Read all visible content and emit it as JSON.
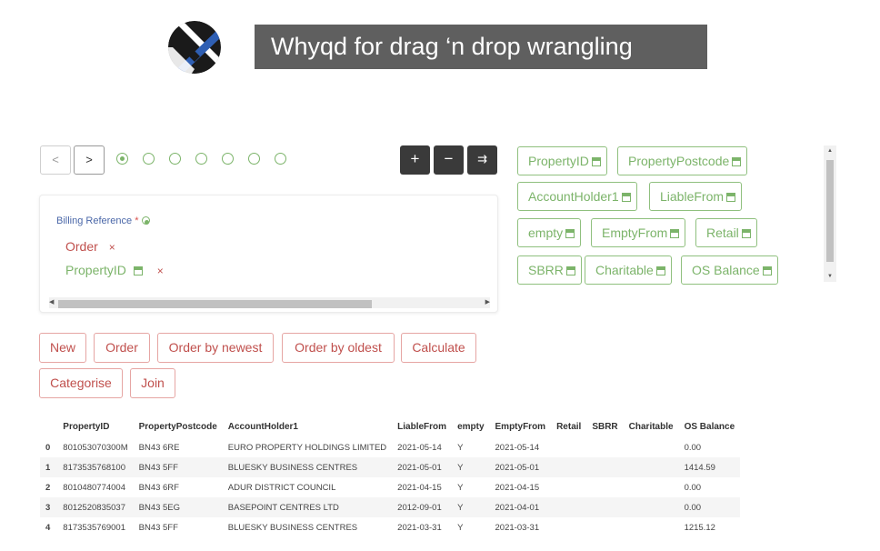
{
  "header": {
    "title": "Whyqd for drag ‘n drop wrangling"
  },
  "pager": {
    "prev_label": "<",
    "next_label": ">",
    "step_count": 7,
    "active_step": 1
  },
  "toolbar": {
    "add_label": "+",
    "remove_label": "−",
    "expand_label": "⇉"
  },
  "card": {
    "billing_label": "Billing Reference",
    "required_mark": "*",
    "items": [
      {
        "label": "Order",
        "remove": "×"
      },
      {
        "label": "PropertyID",
        "remove": "×"
      }
    ]
  },
  "fields": [
    "PropertyID",
    "PropertyPostcode",
    "AccountHolder1",
    "LiableFrom",
    "empty",
    "EmptyFrom",
    "Retail",
    "SBRR",
    "Charitable",
    "OS Balance"
  ],
  "actions": [
    "New",
    "Order",
    "Order by newest",
    "Order by oldest",
    "Calculate",
    "Categorise",
    "Join"
  ],
  "table": {
    "columns": [
      "",
      "PropertyID",
      "PropertyPostcode",
      "AccountHolder1",
      "LiableFrom",
      "empty",
      "EmptyFrom",
      "Retail",
      "SBRR",
      "Charitable",
      "OS Balance"
    ],
    "rows": [
      [
        "0",
        "801053070300M",
        "BN43 6RE",
        "EURO PROPERTY HOLDINGS LIMITED",
        "2021-05-14",
        "Y",
        "2021-05-14",
        "",
        "",
        "",
        "0.00"
      ],
      [
        "1",
        "8173535768100",
        "BN43 5FF",
        "BLUESKY BUSINESS CENTRES",
        "2021-05-01",
        "Y",
        "2021-05-01",
        "",
        "",
        "",
        "1414.59"
      ],
      [
        "2",
        "8010480774004",
        "BN43 6RF",
        "ADUR DISTRICT COUNCIL",
        "2021-04-15",
        "Y",
        "2021-04-15",
        "",
        "",
        "",
        "0.00"
      ],
      [
        "3",
        "8012520835037",
        "BN43 5EG",
        "BASEPOINT CENTRES LTD",
        "2012-09-01",
        "Y",
        "2021-04-01",
        "",
        "",
        "",
        "0.00"
      ],
      [
        "4",
        "8173535769001",
        "BN43 5FF",
        "BLUESKY BUSINESS CENTRES",
        "2021-03-31",
        "Y",
        "2021-03-31",
        "",
        "",
        "",
        "1215.12"
      ]
    ]
  },
  "colors": {
    "accent_green": "#7cb46a",
    "accent_red": "#c0504d",
    "banner_bg": "#5f5f5f",
    "logo_blue": "#2f5fb3"
  }
}
